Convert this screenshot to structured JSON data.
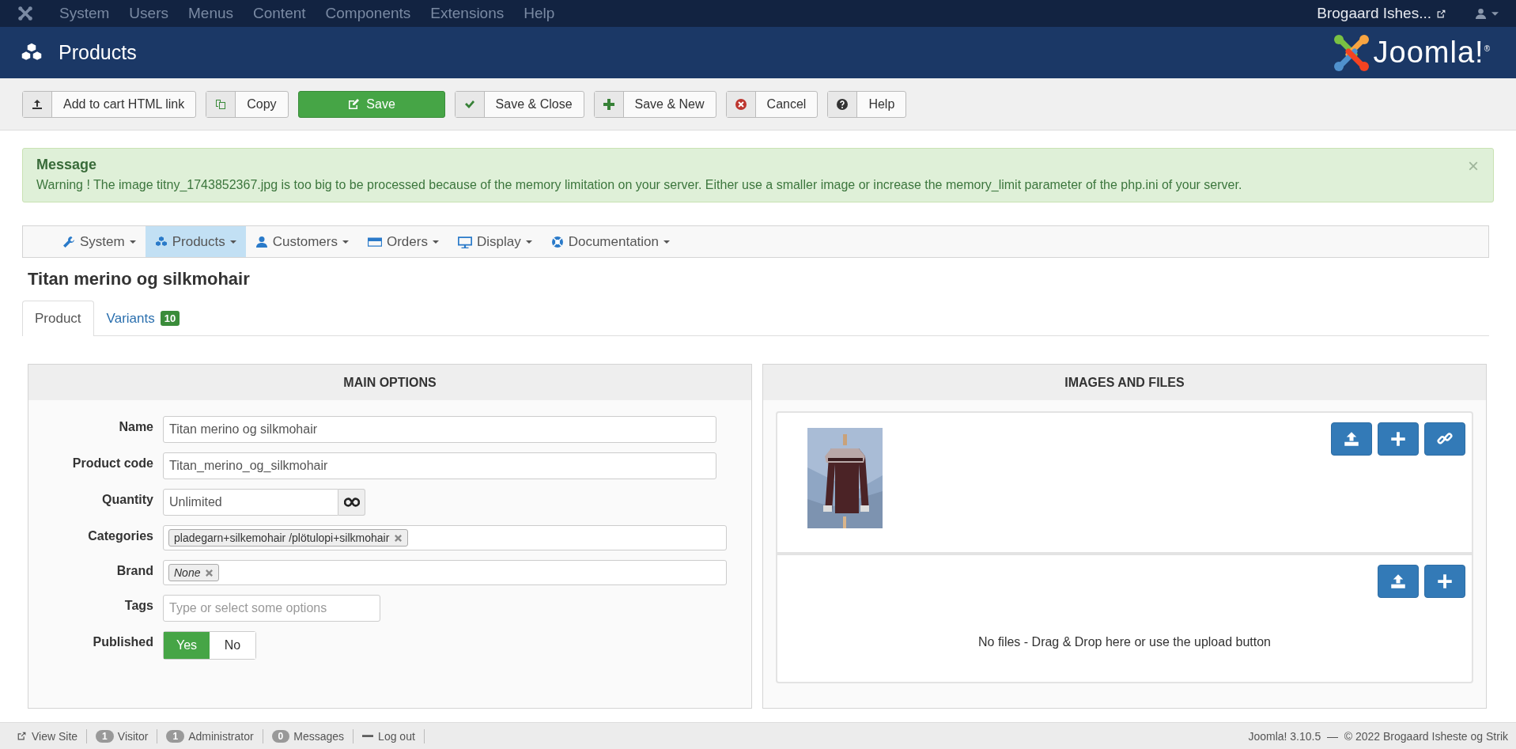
{
  "top_menu": {
    "items": [
      "System",
      "Users",
      "Menus",
      "Content",
      "Components",
      "Extensions",
      "Help"
    ],
    "site_link": "Brogaard Ishes..."
  },
  "header": {
    "title": "Products",
    "logo_text": "Joomla!$^{®}$"
  },
  "toolbar": [
    {
      "kind": "upload",
      "label": "Add to cart HTML link"
    },
    {
      "kind": "copy",
      "label": "Copy"
    },
    {
      "kind": "save",
      "label": "Save"
    },
    {
      "kind": "check",
      "label": "Save & Close"
    },
    {
      "kind": "plus",
      "label": "Save & New"
    },
    {
      "kind": "cancel",
      "label": "Cancel"
    },
    {
      "kind": "help",
      "label": "Help"
    }
  ],
  "message": {
    "heading": "Message",
    "text": "Warning ! The image titny_1743852367.jpg is too big to be processed because of the memory limitation on your server. Either use a smaller image or increase the memory_limit parameter of the php.ini of your server.",
    "close": "×"
  },
  "component_menu": [
    {
      "kind": "wrench",
      "label": "System",
      "selected": false
    },
    {
      "kind": "cubes",
      "label": "Products",
      "selected": true
    },
    {
      "kind": "user",
      "label": "Customers",
      "selected": false
    },
    {
      "kind": "card",
      "label": "Orders",
      "selected": false
    },
    {
      "kind": "monitor",
      "label": "Display",
      "selected": false
    },
    {
      "kind": "lifebuoy",
      "label": "Documentation",
      "selected": false
    }
  ],
  "page_title": "Titan merino og silkmohair",
  "tabs": [
    {
      "label": "Product",
      "selected": true
    },
    {
      "label": "Variants",
      "badge": "10",
      "selected": false
    }
  ],
  "main_options": {
    "title": "MAIN OPTIONS",
    "fields": [
      {
        "kind": "text",
        "label": "Name",
        "value": "Titan merino og silkmohair"
      },
      {
        "kind": "text",
        "label": "Product code",
        "value": "Titan_merino_og_silkmohair"
      },
      {
        "kind": "addon",
        "label": "Quantity",
        "value": "Unlimited"
      },
      {
        "kind": "chips",
        "label": "Categories",
        "chips": [
          "pladegarn+silkemohair /plötulopi+silkmohair"
        ]
      },
      {
        "kind": "chips",
        "label": "Brand",
        "chips": [
          "None"
        ],
        "italic": true
      },
      {
        "kind": "tags",
        "label": "Tags",
        "placeholder": "Type or select some options"
      },
      {
        "kind": "toggle",
        "label": "Published",
        "options": [
          {
            "label": "Yes",
            "selected": true
          },
          {
            "label": "No",
            "selected": false
          }
        ]
      }
    ]
  },
  "images_and_files": {
    "title": "IMAGES AND FILES",
    "files_empty_text": "No files - Drag & Drop here or use the upload button"
  },
  "status_bar": {
    "view_site": "View Site",
    "counters": [
      {
        "count": "1",
        "label": "Visitor"
      },
      {
        "count": "1",
        "label": "Administrator"
      },
      {
        "count": "0",
        "label": "Messages"
      }
    ],
    "logout": "Log out",
    "footer": "Joomla! 3.10.5  —  © 2022 Brogaard Isheste og Strik"
  }
}
